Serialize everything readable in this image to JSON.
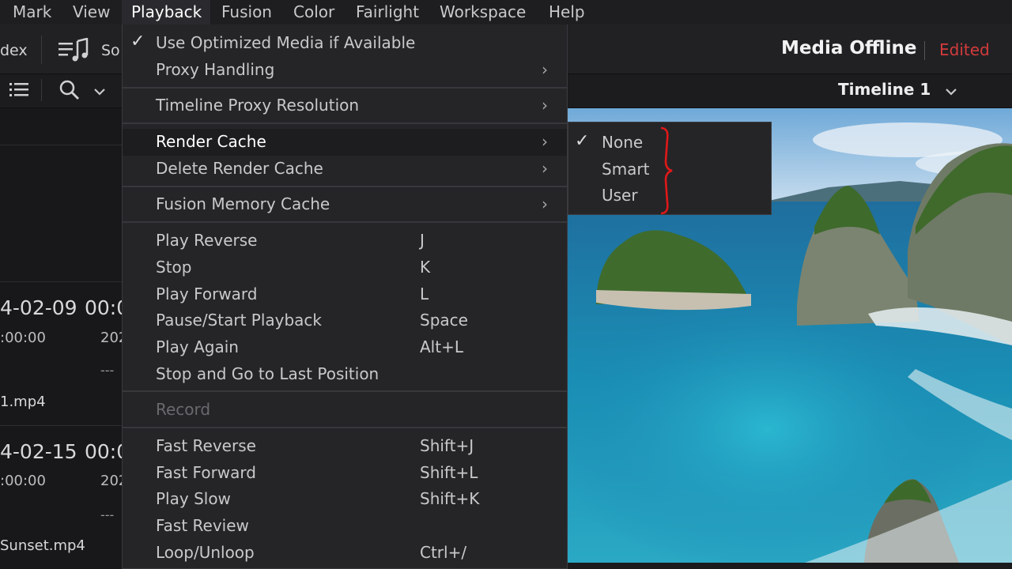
{
  "menubar": {
    "items": [
      "Mark",
      "View",
      "Playback",
      "Fusion",
      "Color",
      "Fairlight",
      "Workspace",
      "Help"
    ]
  },
  "toolbar": {
    "index_label": "dex",
    "sound_label": "So",
    "status": "Media Offline",
    "edited": "Edited"
  },
  "subbar": {
    "timeline": "Timeline 1"
  },
  "pool": {
    "clip1": {
      "date": "4-02-09",
      "time": "00:0",
      "tc": ":00:00",
      "year": "202",
      "dash": "---",
      "file": "1.mp4"
    },
    "clip2": {
      "date": "4-02-15",
      "time": "00:0",
      "tc": ":00:00",
      "year": "202",
      "dash": "---",
      "file": "Sunset.mp4"
    }
  },
  "playback_menu": {
    "use_optimized": "Use Optimized Media if Available",
    "proxy_handling": "Proxy Handling",
    "timeline_proxy": "Timeline Proxy Resolution",
    "render_cache": "Render Cache",
    "delete_render_cache": "Delete Render Cache",
    "fusion_memory_cache": "Fusion Memory Cache",
    "play_reverse": {
      "label": "Play Reverse",
      "shortcut": "J"
    },
    "stop": {
      "label": "Stop",
      "shortcut": "K"
    },
    "play_forward": {
      "label": "Play Forward",
      "shortcut": "L"
    },
    "pause_start": {
      "label": "Pause/Start Playback",
      "shortcut": "Space"
    },
    "play_again": {
      "label": "Play Again",
      "shortcut": "Alt+L"
    },
    "stop_go_last": {
      "label": "Stop and Go to Last Position",
      "shortcut": ""
    },
    "record": "Record",
    "fast_reverse": {
      "label": "Fast Reverse",
      "shortcut": "Shift+J"
    },
    "fast_forward": {
      "label": "Fast Forward",
      "shortcut": "Shift+L"
    },
    "play_slow": {
      "label": "Play Slow",
      "shortcut": "Shift+K"
    },
    "fast_review": {
      "label": "Fast Review",
      "shortcut": ""
    },
    "loop_unloop": {
      "label": "Loop/Unloop",
      "shortcut": "Ctrl+/"
    }
  },
  "render_cache_submenu": {
    "none": "None",
    "smart": "Smart",
    "user": "User",
    "selected": "None"
  },
  "colors": {
    "menu_bg": "#252528",
    "highlight_bg": "#1d1d20",
    "edited_red": "#d43b3b",
    "annotation_red": "#e01818"
  }
}
